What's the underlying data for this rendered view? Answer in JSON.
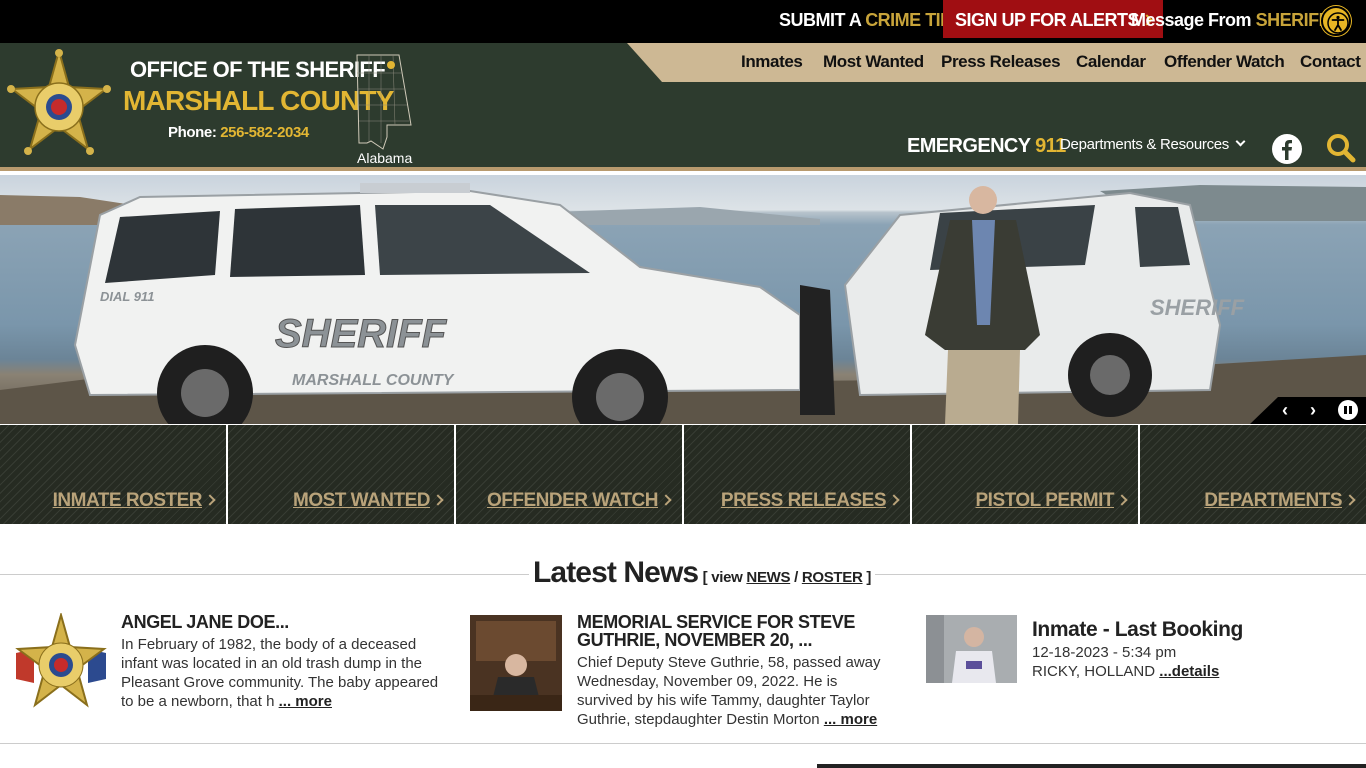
{
  "topbar": {
    "crime_tip_a": "SUBMIT A",
    "crime_tip_b": "CRIME TIP",
    "alerts": "SIGN UP FOR ALERTS",
    "message_a": "Message From",
    "message_b": "SHERIFF"
  },
  "header": {
    "org_line1": "OFFICE OF THE SHERIFF",
    "org_line2": "MARSHALL COUNTY",
    "phone_label": "Phone:",
    "phone": "256-582-2034",
    "state": "Alabama",
    "emergency_label": "EMERGENCY",
    "emergency_number": "911",
    "departments": "Departments & Resources"
  },
  "nav": [
    "Inmates",
    "Most Wanted",
    "Press Releases",
    "Calendar",
    "Offender Watch",
    "Contact"
  ],
  "tiles": [
    "INMATE ROSTER",
    "MOST WANTED",
    "OFFENDER WATCH",
    "PRESS RELEASES",
    "PISTOL PERMIT",
    "DEPARTMENTS"
  ],
  "news": {
    "title": "Latest News",
    "view": "view",
    "news_link": "NEWS",
    "roster_link": "ROSTER",
    "items": [
      {
        "title": "ANGEL JANE DOE...",
        "body": "In February of 1982, the body of a deceased infant was located in an old trash dump in the Pleasant Grove community. The baby appeared to be a newborn, that h",
        "more": "... more"
      },
      {
        "title": "MEMORIAL SERVICE FOR STEVE GUTHRIE, NOVEMBER 20, ...",
        "body": "Chief Deputy Steve Guthrie, 58, passed away Wednesday, November 09, 2022. He is survived by his wife Tammy, daughter Taylor Guthrie, stepdaughter Destin Morton",
        "more": "... more"
      }
    ],
    "booking": {
      "title": "Inmate - Last Booking",
      "date": "12-18-2023 - 5:34 pm",
      "name": "RICKY, HOLLAND",
      "details": "...details"
    }
  },
  "colors": {
    "header_green": "#2d3b2e",
    "gold": "#e2b633",
    "alert_red": "#a00e12",
    "tan": "#cdb894"
  },
  "icons": [
    "accessibility-icon",
    "facebook-icon",
    "search-icon",
    "chevron-right-icon",
    "chevron-down-icon",
    "pause-icon"
  ]
}
